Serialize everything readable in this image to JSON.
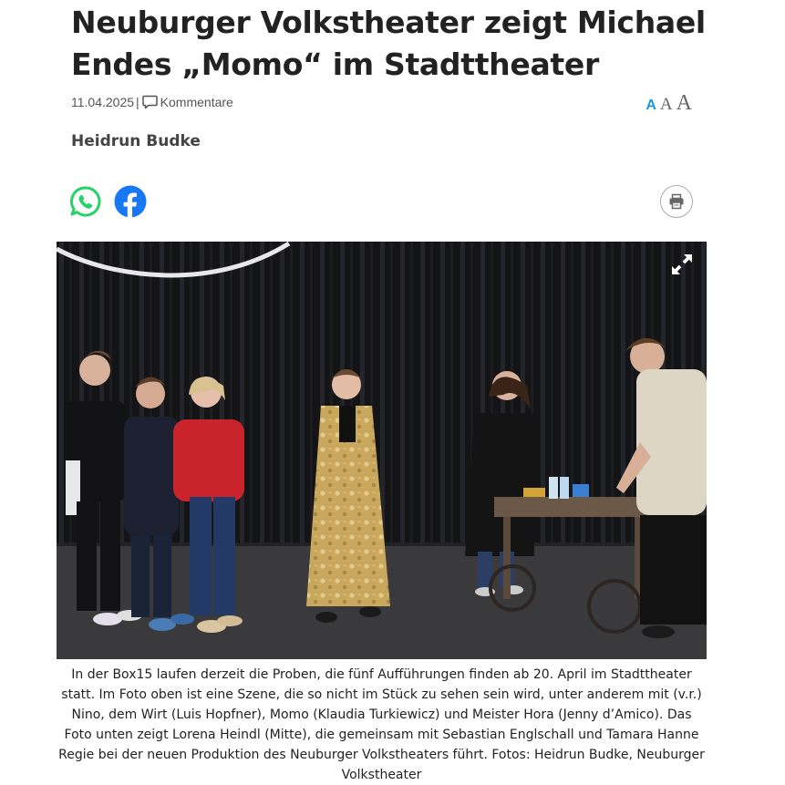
{
  "article": {
    "title": "Neuburger Volkstheater zeigt Michael Endes „Momo“ im Stadttheater",
    "date": "11.04.2025",
    "separator": "|",
    "comments_label": "Kommentare",
    "author": "Heidrun Budke",
    "caption": "In der Box15 laufen derzeit die Proben, die fünf Aufführungen finden ab 20. April im Stadttheater statt. Im Foto oben ist eine Szene, die so nicht im Stück zu sehen sein wird, unter anderem mit (v.r.) Nino, dem Wirt (Luis Hopfner), Momo (Klaudia Turkiewicz) und Meister Hora (Jenny d’Amico). Das Foto unten zeigt Lorena Heindl (Mitte), die gemeinsam mit Sebastian Englschall und Tamara Hanne Regie bei der neuen Produktion des Neuburger Volkstheaters führt. Fotos: Heidrun Budke, Neuburger Volkstheater"
  },
  "font_size_controls": {
    "small": "A",
    "medium": "A",
    "large": "A",
    "active_color": "#1a9bd7"
  },
  "share": {
    "whatsapp_icon": "whatsapp-icon",
    "facebook_icon": "facebook-icon",
    "print_icon": "printer-icon",
    "whatsapp_color": "#25d366",
    "facebook_color": "#1877f2"
  },
  "photo": {
    "expand_icon": "expand-icon"
  }
}
